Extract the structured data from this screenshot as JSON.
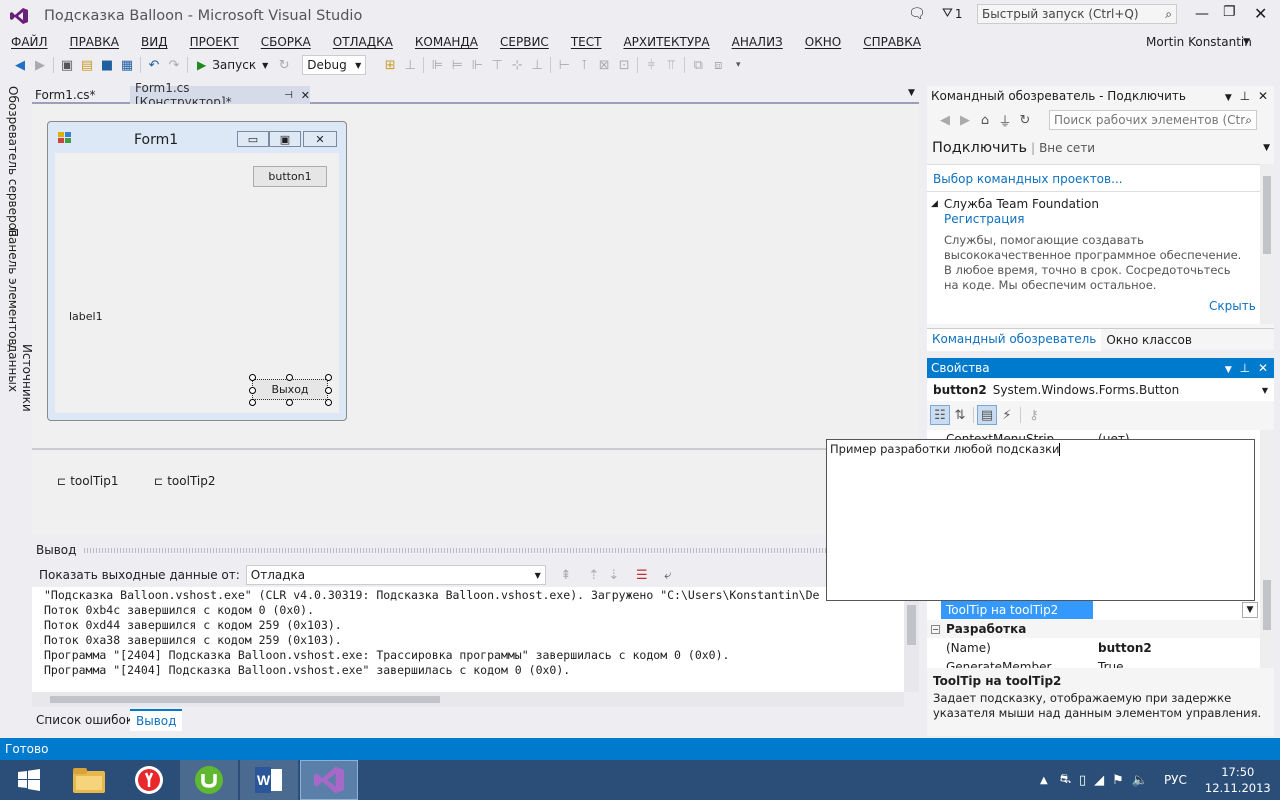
{
  "titlebar": {
    "title": "Подсказка Balloon - Microsoft Visual Studio",
    "flag_count": "1",
    "quicklaunch_placeholder": "Быстрый запуск (Ctrl+Q)",
    "user": "Mortin Konstantin"
  },
  "menu": [
    "ФАЙЛ",
    "ПРАВКА",
    "ВИД",
    "ПРОЕКТ",
    "СБОРКА",
    "ОТЛАДКА",
    "КОМАНДА",
    "СЕРВИС",
    "ТЕСТ",
    "АРХИТЕКТУРА",
    "АНАЛИЗ",
    "ОКНО",
    "СПРАВКА"
  ],
  "toolbar": {
    "start_label": "Запуск",
    "config": "Debug"
  },
  "lefttabs": [
    "Обозреватель серверов",
    "Панель элементов",
    "Источники данных"
  ],
  "doctabs": {
    "tab1": "Form1.cs*",
    "tab2": "Form1.cs [Конструктор]*"
  },
  "form": {
    "title": "Form1",
    "button1": "button1",
    "label1": "label1",
    "exit_button": "Выход"
  },
  "tray": {
    "tooltip1": "toolTip1",
    "tooltip2": "toolTip2"
  },
  "output": {
    "title": "Вывод",
    "show_label": "Показать выходные данные от:",
    "source": "Отладка",
    "lines": [
      "\"Подсказка Balloon.vshost.exe\" (CLR v4.0.30319: Подсказка Balloon.vshost.exe). Загружено \"C:\\Users\\Konstantin\\De",
      "Поток 0xb4c завершился с кодом 0 (0x0).",
      "Поток 0xd44 завершился с кодом 259 (0x103).",
      "Поток 0xa38 завершился с кодом 259 (0x103).",
      "Программа \"[2404] Подсказка Balloon.vshost.exe: Трассировка программы\" завершилась с кодом 0 (0x0).",
      "Программа \"[2404] Подсказка Balloon.vshost.exe\" завершилась с кодом 0 (0x0)."
    ],
    "tab_errors": "Список ошибок",
    "tab_output": "Вывод"
  },
  "team": {
    "header": "Командный обозреватель - Подключить",
    "search_placeholder": "Поиск рабочих элементов (Ctr",
    "connect": "Подключить",
    "offline": "Вне сети",
    "select_projects": "Выбор командных проектов...",
    "service": "Служба Team Foundation",
    "register": "Регистрация",
    "desc": "Службы, помогающие создавать высококачественное программное обеспечение. В любое время, точно в срок. Сосредоточьтесь на коде. Мы обеспечим остальное.",
    "hide": "Скрыть",
    "tab_team": "Командный обозреватель",
    "tab_classes": "Окно классов"
  },
  "props": {
    "header": "Свойства",
    "object_name": "button2",
    "object_type": "System.Windows.Forms.Button",
    "row_cms_name": "ContextMenuStrip",
    "row_cms_value": "(нет)",
    "tooltip_value": "ToolTip на toolTip2",
    "category": "Разработка",
    "row_name": "(Name)",
    "row_name_value": "button2",
    "row_gm": "GenerateMember",
    "row_gm_value": "True",
    "desc_title": "ToolTip на toolTip2",
    "desc_text": "Задает подсказку, отображаемую при задержке указателя мыши над данным элементом управления."
  },
  "editor_popup": {
    "text": "Пример разработки любой подсказки"
  },
  "status": {
    "text": "Готово"
  },
  "taskbar": {
    "lang": "РУС",
    "time": "17:50",
    "date": "12.11.2013"
  }
}
